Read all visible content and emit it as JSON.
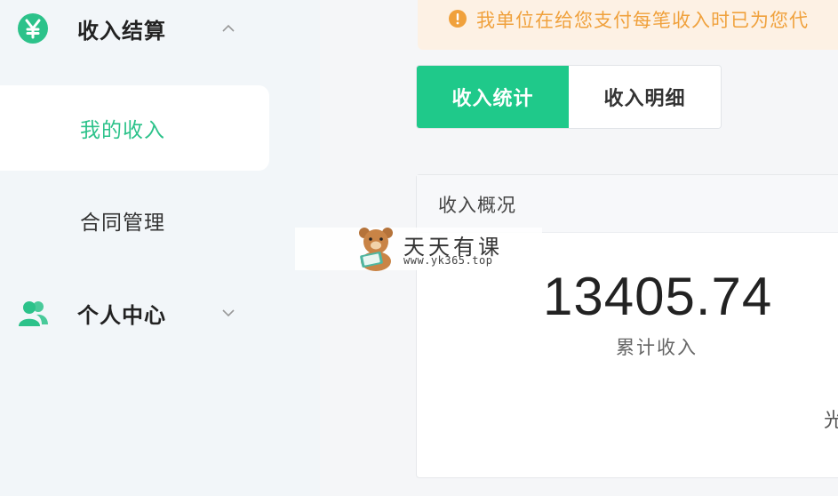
{
  "sidebar": {
    "groups": [
      {
        "label": "收入结算",
        "icon": "yen-circle-icon",
        "expanded": true
      },
      {
        "label": "个人中心",
        "icon": "users-icon",
        "expanded": false
      }
    ],
    "items": [
      {
        "label": "我的收入",
        "active": true
      },
      {
        "label": "合同管理",
        "active": false
      }
    ]
  },
  "notice": {
    "text": "我单位在给您支付每笔收入时已为您代",
    "icon": "exclamation-circle-icon"
  },
  "tabs": [
    {
      "label": "收入统计",
      "active": true
    },
    {
      "label": "收入明细",
      "active": false
    }
  ],
  "overview": {
    "title": "收入概况",
    "total": "13405.74",
    "total_label": "累计收入",
    "partial_text": "光"
  },
  "watermark": {
    "title": "天天有课",
    "url": "www.yk365.top"
  },
  "colors": {
    "accent": "#1fc98a",
    "warning": "#f0a13c",
    "notice_bg": "#fdf1e4"
  }
}
